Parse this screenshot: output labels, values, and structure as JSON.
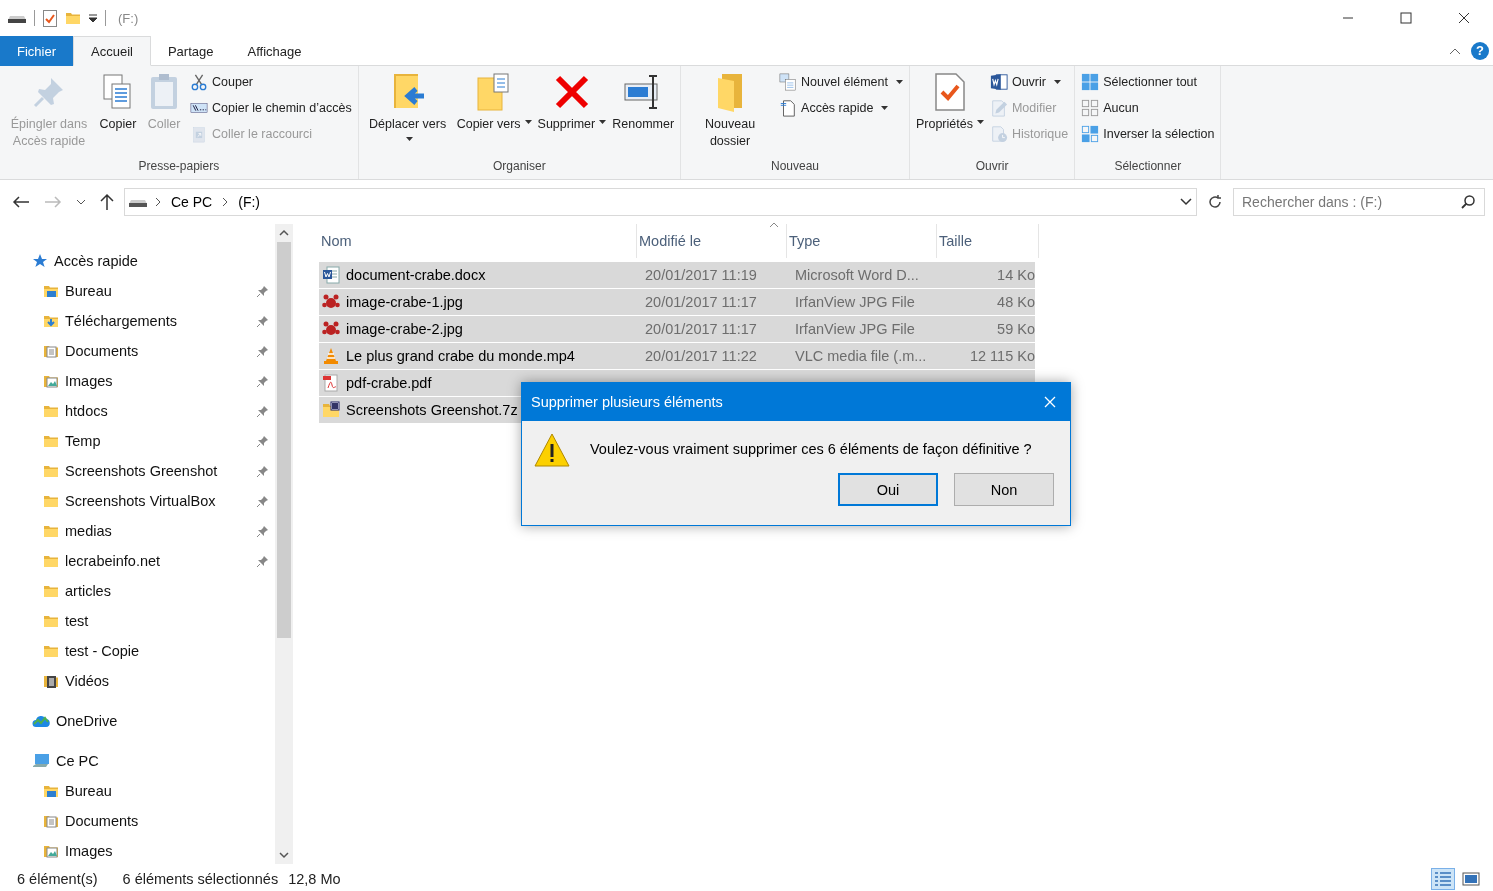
{
  "window": {
    "title": "(F:)"
  },
  "tabs": [
    {
      "label": "Fichier",
      "kind": "file",
      "selected": false
    },
    {
      "label": "Accueil",
      "kind": "tab",
      "selected": true
    },
    {
      "label": "Partage",
      "kind": "tab",
      "selected": false
    },
    {
      "label": "Affichage",
      "kind": "tab",
      "selected": false
    }
  ],
  "help": "?",
  "ribbon": [
    {
      "label": "Presse-papiers",
      "items": [
        {
          "label": "Épingler dans Accès rapide",
          "kind": "large",
          "disabled": true,
          "dropdown": false
        },
        {
          "label": "Copier",
          "kind": "large",
          "disabled": false,
          "dropdown": false
        },
        {
          "label": "Coller",
          "kind": "large",
          "disabled": true,
          "dropdown": false
        },
        {
          "label": "Couper",
          "kind": "small",
          "disabled": false,
          "dropdown": false
        },
        {
          "label": "Copier le chemin d’accès",
          "kind": "small",
          "disabled": false,
          "dropdown": false
        },
        {
          "label": "Coller le raccourci",
          "kind": "small",
          "disabled": true,
          "dropdown": false
        }
      ]
    },
    {
      "label": "Organiser",
      "items": [
        {
          "label": "Déplacer vers",
          "kind": "large",
          "disabled": false,
          "dropdown": true
        },
        {
          "label": "Copier vers",
          "kind": "large",
          "disabled": false,
          "dropdown": true
        },
        {
          "label": "Supprimer",
          "kind": "large",
          "disabled": false,
          "dropdown": true
        },
        {
          "label": "Renommer",
          "kind": "large",
          "disabled": false,
          "dropdown": false
        }
      ]
    },
    {
      "label": "Nouveau",
      "items": [
        {
          "label": "Nouveau dossier",
          "kind": "large",
          "disabled": false,
          "dropdown": false
        },
        {
          "label": "Nouvel élément",
          "kind": "small",
          "disabled": false,
          "dropdown": true
        },
        {
          "label": "Accès rapide",
          "kind": "small",
          "disabled": false,
          "dropdown": true
        }
      ]
    },
    {
      "label": "Ouvrir",
      "items": [
        {
          "label": "Propriétés",
          "kind": "large",
          "disabled": false,
          "dropdown": true
        },
        {
          "label": "Ouvrir",
          "kind": "small",
          "disabled": false,
          "dropdown": true
        },
        {
          "label": "Modifier",
          "kind": "small",
          "disabled": true,
          "dropdown": false
        },
        {
          "label": "Historique",
          "kind": "small",
          "disabled": true,
          "dropdown": false
        }
      ]
    },
    {
      "label": "Sélectionner",
      "items": [
        {
          "label": "Sélectionner tout",
          "kind": "small",
          "disabled": false,
          "dropdown": false
        },
        {
          "label": "Aucun",
          "kind": "small",
          "disabled": false,
          "dropdown": false
        },
        {
          "label": "Inverser la sélection",
          "kind": "small",
          "disabled": false,
          "dropdown": false
        }
      ]
    }
  ],
  "address": {
    "segments": [
      "Ce PC",
      "(F:)"
    ]
  },
  "search": {
    "placeholder": "Rechercher dans : (F:)"
  },
  "sidebar": {
    "items": [
      {
        "label": "Accès rapide",
        "kind": "star",
        "children": [
          {
            "label": "Bureau",
            "kind": "desktop",
            "pinned": true
          },
          {
            "label": "Téléchargements",
            "kind": "download",
            "pinned": true
          },
          {
            "label": "Documents",
            "kind": "docs",
            "pinned": true
          },
          {
            "label": "Images",
            "kind": "images",
            "pinned": true
          },
          {
            "label": "htdocs",
            "kind": "folder",
            "pinned": true
          },
          {
            "label": "Temp",
            "kind": "folder",
            "pinned": true
          },
          {
            "label": "Screenshots Greenshot",
            "kind": "folder",
            "pinned": true
          },
          {
            "label": "Screenshots VirtualBox",
            "kind": "folder",
            "pinned": true
          },
          {
            "label": "medias",
            "kind": "folder",
            "pinned": true
          },
          {
            "label": "lecrabeinfo.net",
            "kind": "folder",
            "pinned": true
          },
          {
            "label": "articles",
            "kind": "folder",
            "pinned": false
          },
          {
            "label": "test",
            "kind": "folder",
            "pinned": false
          },
          {
            "label": "test - Copie",
            "kind": "folder",
            "pinned": false
          },
          {
            "label": "Vidéos",
            "kind": "videos",
            "pinned": false
          }
        ]
      },
      {
        "label": "OneDrive",
        "kind": "cloud"
      },
      {
        "label": "Ce PC",
        "kind": "pc",
        "children": [
          {
            "label": "Bureau",
            "kind": "desktop",
            "pinned": false
          },
          {
            "label": "Documents",
            "kind": "docs",
            "pinned": false
          },
          {
            "label": "Images",
            "kind": "images",
            "pinned": false
          }
        ]
      }
    ]
  },
  "table": {
    "columns": [
      "Nom",
      "Modifié le",
      "Type",
      "Taille"
    ],
    "rows": [
      {
        "name": "document-crabe.docx",
        "modified": "20/01/2017 11:19",
        "type": "Microsoft Word D...",
        "size": "14 Ko",
        "kind": "word",
        "selected": true
      },
      {
        "name": "image-crabe-1.jpg",
        "modified": "20/01/2017 11:17",
        "type": "IrfanView JPG File",
        "size": "48 Ko",
        "kind": "image",
        "selected": true
      },
      {
        "name": "image-crabe-2.jpg",
        "modified": "20/01/2017 11:17",
        "type": "IrfanView JPG File",
        "size": "59 Ko",
        "kind": "image",
        "selected": true
      },
      {
        "name": "Le plus grand crabe du monde.mp4",
        "modified": "20/01/2017 11:22",
        "type": "VLC media file (.m...",
        "size": "12 115 Ko",
        "kind": "video",
        "selected": true
      },
      {
        "name": "pdf-crabe.pdf",
        "kind": "pdf",
        "selected": true
      },
      {
        "name": "Screenshots Greenshot.7z",
        "kind": "archive",
        "selected": true
      }
    ]
  },
  "status_bar": {
    "count": "6 élément(s)",
    "selection": "6 éléments sélectionnés",
    "size": "12,8 Mo"
  },
  "dialog": {
    "title": "Supprimer plusieurs éléments",
    "message": "Voulez-vous vraiment supprimer ces 6 éléments de façon définitive ?",
    "buttons": [
      {
        "label": "Oui",
        "default": true
      },
      {
        "label": "Non",
        "default": false
      }
    ]
  }
}
